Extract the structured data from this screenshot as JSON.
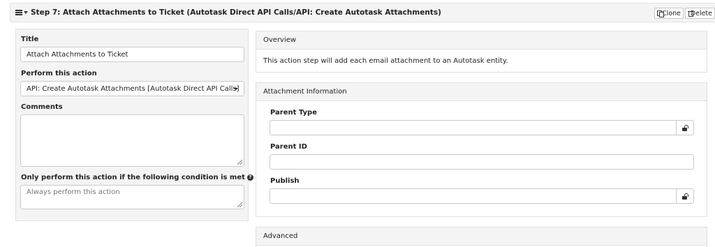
{
  "step": {
    "title": "Step 7: Attach Attachments to Ticket (Autotask Direct API Calls/API: Create Autotask Attachments)",
    "clone_label": "Clone",
    "delete_label": "Delete"
  },
  "form": {
    "title_label": "Title",
    "title_value": "Attach Attachments to Ticket",
    "action_label": "Perform this action",
    "action_value": "API: Create Autotask Attachments [Autotask Direct API Calls]",
    "comments_label": "Comments",
    "comments_value": "",
    "condition_label": "Only perform this action if the following condition is met",
    "condition_placeholder": "Always perform this action"
  },
  "overview": {
    "header": "Overview",
    "text": "This action step will add each email attachment to an Autotask entity."
  },
  "attachment_info": {
    "header": "Attachment Information",
    "parent_type_label": "Parent Type",
    "parent_type_value": "",
    "parent_id_label": "Parent ID",
    "parent_id_value": "",
    "publish_label": "Publish",
    "publish_value": ""
  },
  "advanced": {
    "header": "Advanced"
  },
  "icons": {
    "menu": "hamburger-icon",
    "collapse": "caret-down-icon",
    "clone": "copy-icon",
    "delete": "trash-icon",
    "help": "question-circle-icon",
    "lock": "unlock-icon"
  }
}
